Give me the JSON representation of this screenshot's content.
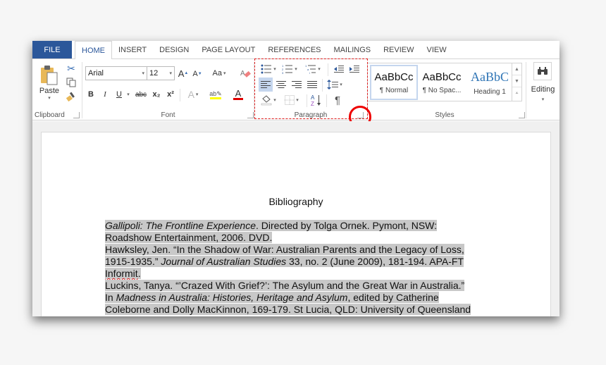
{
  "ribbon_tabs": [
    "FILE",
    "HOME",
    "INSERT",
    "DESIGN",
    "PAGE LAYOUT",
    "REFERENCES",
    "MAILINGS",
    "REVIEW",
    "VIEW"
  ],
  "clipboard": {
    "paste_label": "Paste",
    "group_label": "Clipboard"
  },
  "font": {
    "font_name": "Arial",
    "font_size": "12",
    "change_case_label": "Aa",
    "group_label": "Font",
    "bold": "B",
    "italic": "I",
    "underline": "U",
    "strikethrough": "abc",
    "subscript": "x₂",
    "superscript": "x²"
  },
  "paragraph": {
    "group_label": "Paragraph",
    "show_marks": "¶"
  },
  "styles": {
    "group_label": "Styles",
    "items": [
      {
        "sample": "AaBbCc",
        "name": "¶ Normal"
      },
      {
        "sample": "AaBbCc",
        "name": "¶ No Spac..."
      },
      {
        "sample": "AaBbC",
        "name": "Heading 1"
      }
    ]
  },
  "editing": {
    "label": "Editing"
  },
  "colors": {
    "file_tab": "#2b579a",
    "highlight_yellow": "#ffff00",
    "font_red": "#e00000",
    "heading_blue": "#2e74b5",
    "annotation_red": "#e02020"
  },
  "document": {
    "title": "Bibliography",
    "lines": {
      "l1_italic": "Gallipoli: The Frontline Experience",
      "l1_rest": ". Directed by Tolga Ornek. Pymont, NSW:",
      "l2": "Roadshow Entertainment, 2006. DVD.",
      "l3": "Hawksley, Jen. “In the Shadow of War: Australian Parents and the Legacy of Loss,",
      "l4_a": "1915-1935.” ",
      "l4_italic": "Journal of Australian Studies",
      "l4_b": " 33, no. 2 (June 2009), 181-194. APA-FT",
      "l5": "Informit",
      "l5_dot": ".",
      "l6": "Luckins, Tanya. “’Crazed With Grief?’: The Asylum and the Great War in Australia.”",
      "l7_a": "In ",
      "l7_italic": "Madness in Australia: Histories, Heritage and Asylum",
      "l7_b": ", edited by Catherine",
      "l8": "Coleborne and Dolly MacKinnon, 169-179. St Lucia, QLD: University of Queensland"
    }
  }
}
